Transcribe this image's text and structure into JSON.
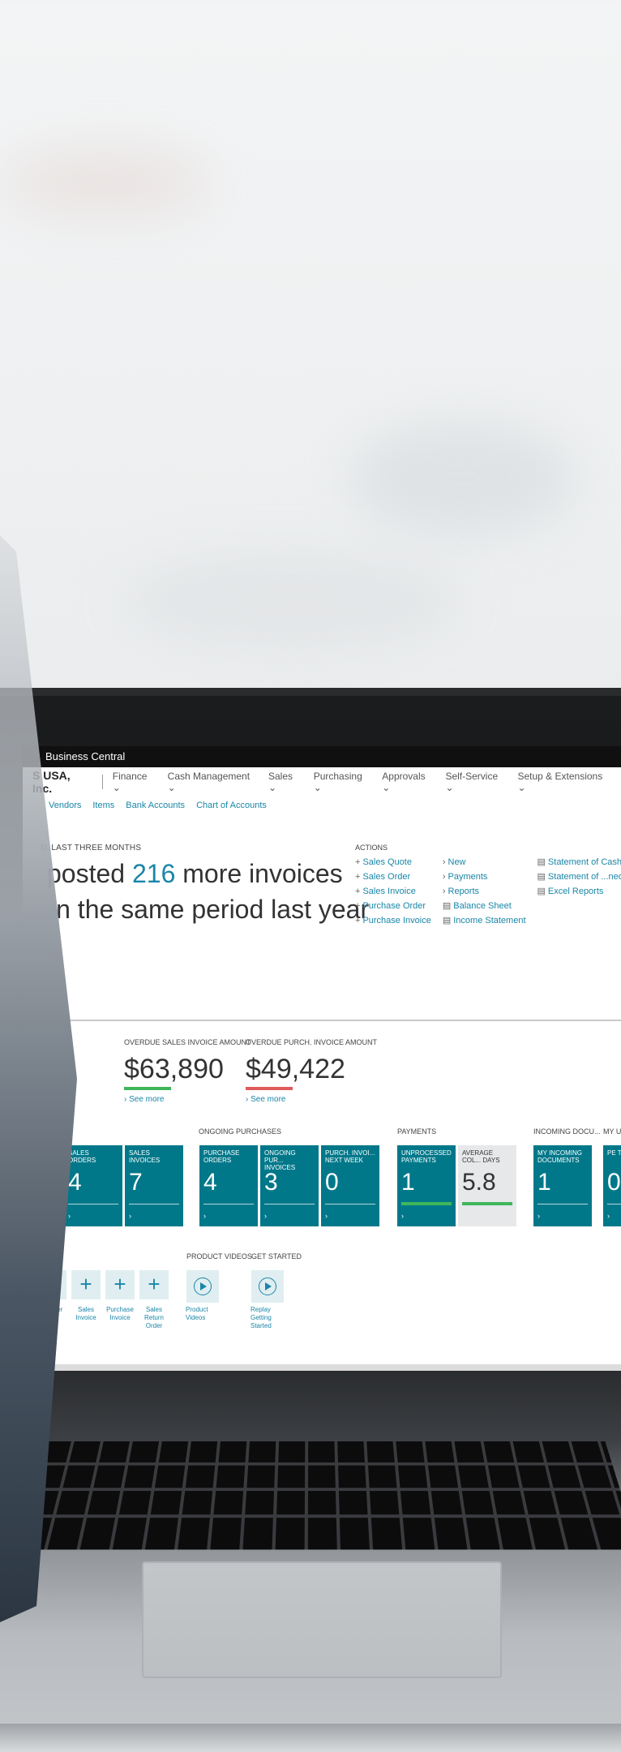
{
  "app": {
    "title": "Business Central"
  },
  "company": {
    "name": "S USA, Inc."
  },
  "nav": {
    "items": [
      "Finance",
      "Cash Management",
      "Sales",
      "Purchasing",
      "Approvals",
      "Self-Service",
      "Setup & Extensions"
    ],
    "subitems": [
      "Vendors",
      "Items",
      "Bank Accounts",
      "Chart of Accounts"
    ]
  },
  "headline": {
    "label": "D, LAST THREE MONTHS",
    "line1_prefix": "posted ",
    "line1_number": "216",
    "line1_suffix": " more invoices",
    "line2": "in the same period last year"
  },
  "actions": {
    "title": "ACTIONS",
    "col1": [
      "Sales Quote",
      "Sales Order",
      "Sales Invoice",
      "Purchase Order",
      "Purchase Invoice"
    ],
    "col2": [
      "New",
      "Payments",
      "Reports",
      "Balance Sheet",
      "Income Statement"
    ],
    "col3": [
      "Statement of Cash Flows",
      "Statement of ...ned Earnings",
      "Excel Reports"
    ]
  },
  "kpis": [
    {
      "label": "OVERDUE SALES INVOICE AMOUNT",
      "value": "$63,890",
      "color": "#3fb65a",
      "more": "See more"
    },
    {
      "label": "OVERDUE PURCH. INVOICE AMOUNT",
      "value": "$49,422",
      "color": "#e05a5a",
      "more": "See more"
    }
  ],
  "groups": {
    "ongoing_purchases": "ONGOING PURCHASES",
    "payments": "PAYMENTS",
    "incoming": "INCOMING DOCU...",
    "my": "MY U",
    "product_videos": "PRODUCT VIDEOS",
    "get_started": "GET STARTED"
  },
  "tiles": [
    {
      "label": "",
      "value": "4"
    },
    {
      "label": "SALES ORDERS",
      "value": "4"
    },
    {
      "label": "SALES INVOICES",
      "value": "7"
    },
    {
      "label": "PURCHASE ORDERS",
      "value": "4"
    },
    {
      "label": "ONGOING PUR... INVOICES",
      "value": "3"
    },
    {
      "label": "PURCH. INVOI... NEXT WEEK",
      "value": "0"
    },
    {
      "label": "UNPROCESSED PAYMENTS",
      "value": "1"
    },
    {
      "label": "AVERAGE COL... DAYS",
      "value": "5.8"
    },
    {
      "label": "MY INCOMING DOCUMENTS",
      "value": "1"
    },
    {
      "label": "PE TA",
      "value": "0"
    }
  ],
  "shortcuts": [
    {
      "label": "les rder"
    },
    {
      "label": "Sales Invoice"
    },
    {
      "label": "Purchase Invoice"
    },
    {
      "label": "Sales Return Order"
    }
  ],
  "videos": [
    {
      "label": "Product Videos"
    },
    {
      "label": "Replay Getting Started"
    }
  ],
  "colors": {
    "accent": "#1a86a8",
    "tile": "#00788a"
  }
}
